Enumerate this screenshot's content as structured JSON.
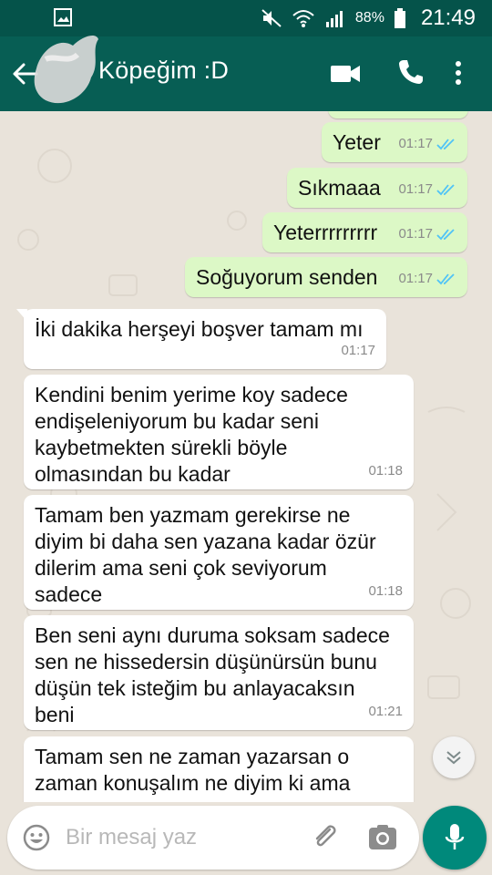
{
  "status_bar": {
    "battery": "88%",
    "time": "21:49"
  },
  "header": {
    "contact_name": "Köpeğim :D"
  },
  "messages": [
    {
      "direction": "out",
      "text": "Yeter",
      "time": "01:17"
    },
    {
      "direction": "out",
      "text": "Sıkmaaa",
      "time": "01:17"
    },
    {
      "direction": "out",
      "text": "Yeterrrrrrrrr",
      "time": "01:17"
    },
    {
      "direction": "out",
      "text": "Soğuyorum senden",
      "time": "01:17"
    },
    {
      "direction": "in",
      "text": "İki dakika herşeyi boşver tamam mı",
      "time": "01:17"
    },
    {
      "direction": "in",
      "text": "Kendini benim yerime koy sadece\nendişeleniyorum bu kadar seni\nkaybetmekten sürekli böyle\nolmasından bu kadar",
      "time": "01:18"
    },
    {
      "direction": "in",
      "text": "Tamam ben yazmam gerekirse ne\ndiyim bi daha sen yazana kadar özür\ndilerim ama seni çok seviyorum\nsadece",
      "time": "01:18"
    },
    {
      "direction": "in",
      "text": "Ben seni aynı duruma soksam sadece\nsen ne hissedersin düşünürsün bunu\ndüşün tek isteğim bu anlayacaksın\nbeni",
      "time": "01:21"
    },
    {
      "direction": "in",
      "text": "Tamam sen ne zaman yazarsan o\nzaman konuşalım ne diyim ki ama",
      "time": ""
    }
  ],
  "composer": {
    "placeholder": "Bir mesaj yaz"
  },
  "colors": {
    "header": "#075e54",
    "status": "#05534a",
    "outgoing": "#dcf8c6",
    "incoming": "#ffffff",
    "fab": "#00897b",
    "tick": "#4fc3f7"
  },
  "icons": [
    "image-icon",
    "mute-icon",
    "wifi-icon",
    "signal-icon",
    "battery-icon",
    "back-arrow-icon",
    "video-call-icon",
    "phone-icon",
    "more-vert-icon",
    "double-check-icon",
    "scroll-down-icon",
    "emoji-icon",
    "attach-icon",
    "camera-icon",
    "mic-icon"
  ]
}
